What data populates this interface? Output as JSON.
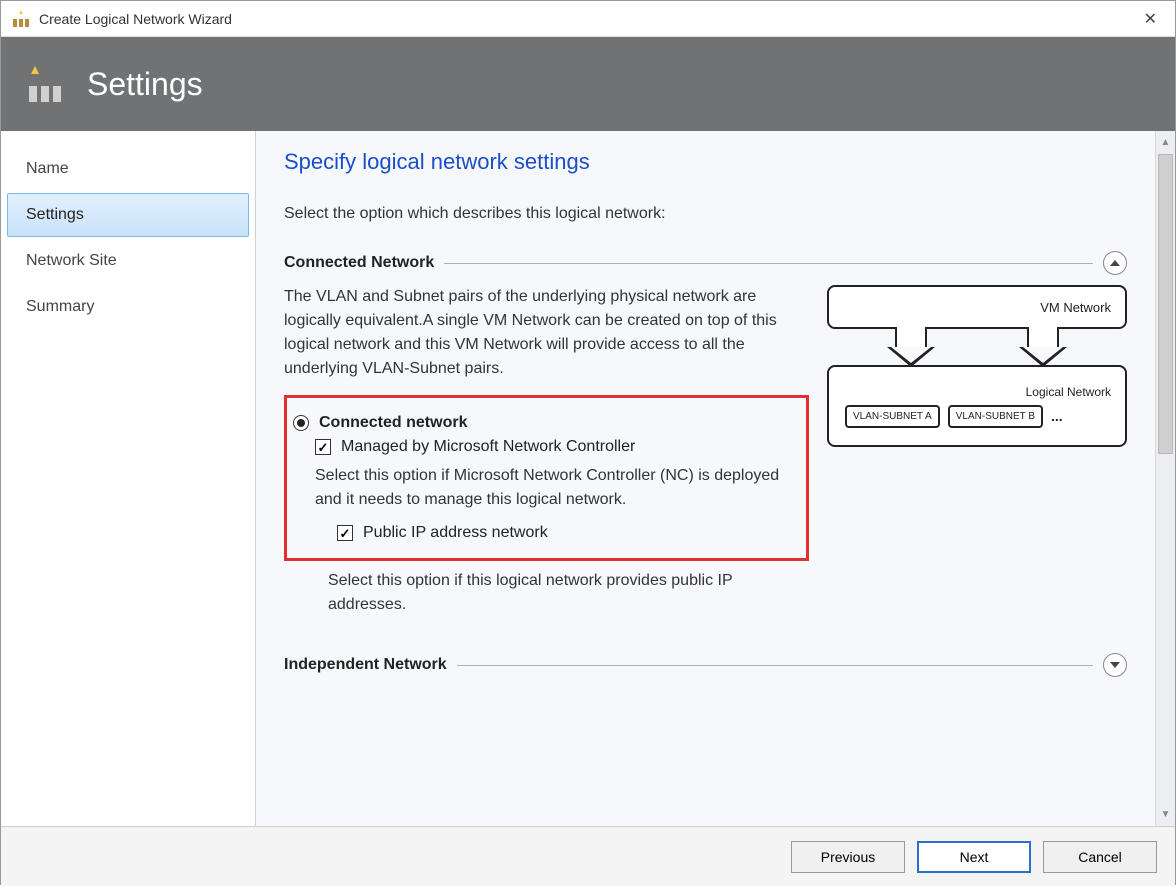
{
  "window": {
    "title": "Create Logical Network Wizard"
  },
  "banner": {
    "title": "Settings"
  },
  "sidebar": {
    "items": [
      {
        "label": "Name",
        "selected": false
      },
      {
        "label": "Settings",
        "selected": true
      },
      {
        "label": "Network Site",
        "selected": false
      },
      {
        "label": "Summary",
        "selected": false
      }
    ]
  },
  "content": {
    "heading": "Specify logical network settings",
    "instruction": "Select the option which describes this logical network:",
    "sections": {
      "connected": {
        "title": "Connected Network",
        "expanded": true,
        "description": "The VLAN and Subnet pairs of the underlying physical network are logically equivalent.A single VM Network can be created on top of this logical network and this VM Network will provide access to all the underlying VLAN-Subnet pairs.",
        "radio": {
          "label": "Connected network",
          "checked": true
        },
        "managed_checkbox": {
          "label": "Managed by Microsoft Network Controller",
          "checked": true
        },
        "managed_helper": "Select this option if Microsoft Network Controller (NC) is deployed and it needs to manage this logical network.",
        "publicip_checkbox": {
          "label": "Public IP address network",
          "checked": true
        },
        "publicip_helper": "Select this option if this logical network provides public IP addresses."
      },
      "independent": {
        "title": "Independent Network",
        "expanded": false
      }
    },
    "diagram": {
      "vm_network": "VM Network",
      "logical_network": "Logical  Network",
      "subnet_a": "VLAN-SUBNET A",
      "subnet_b": "VLAN-SUBNET B",
      "ellipsis": "..."
    }
  },
  "footer": {
    "previous": "Previous",
    "next": "Next",
    "cancel": "Cancel"
  }
}
